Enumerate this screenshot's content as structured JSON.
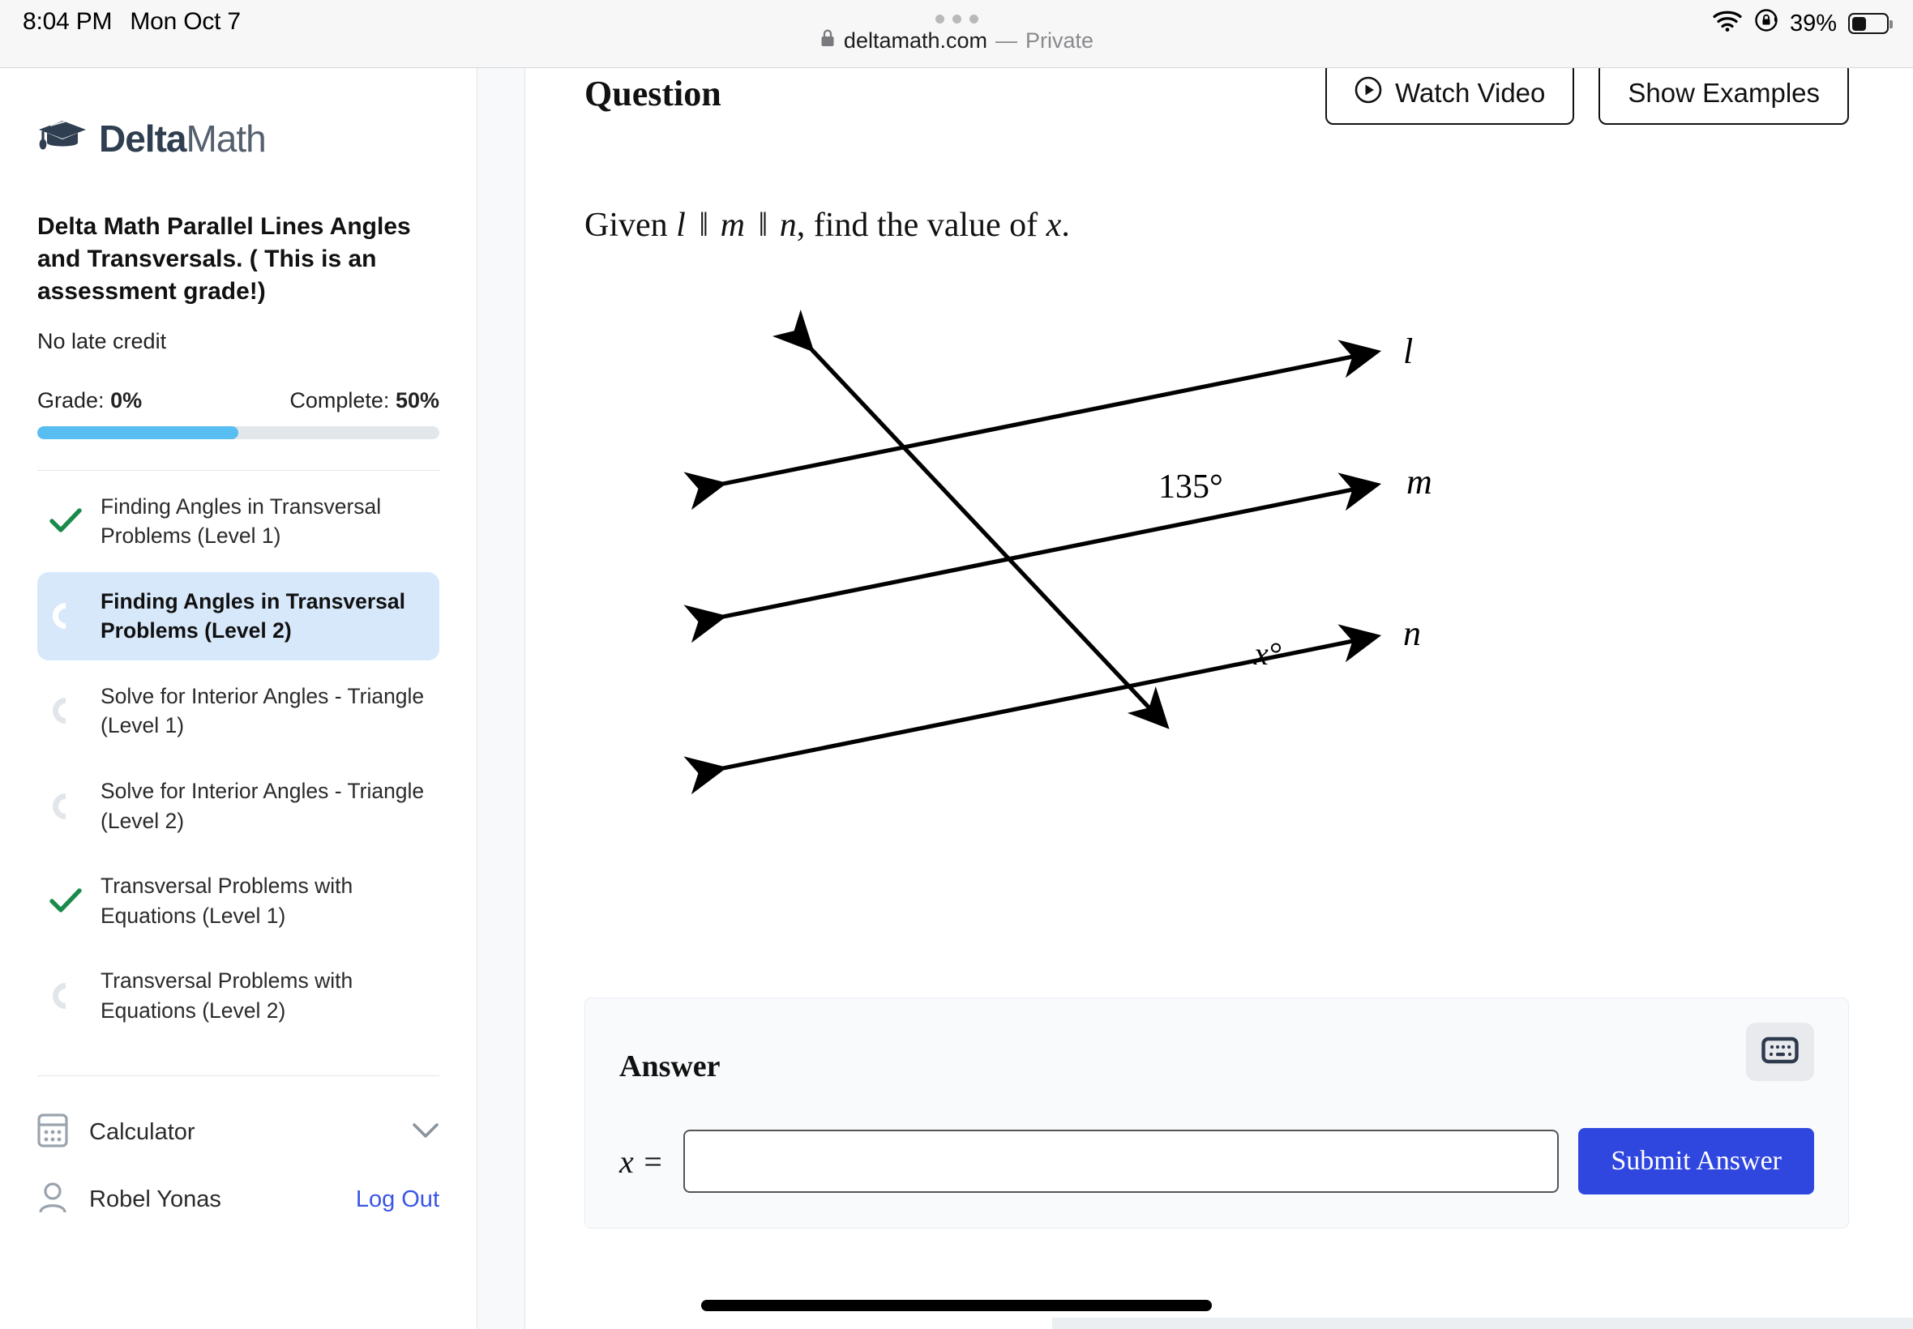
{
  "statusbar": {
    "time": "8:04 PM",
    "date": "Mon Oct 7",
    "battery_percent": "39%",
    "wifi_icon": "wifi-icon",
    "rotation_lock_icon": "rotation-lock-icon",
    "battery_icon": "battery-icon",
    "battery_level": 39
  },
  "browser": {
    "lock_icon": "lock-icon",
    "host": "deltamath.com",
    "separator": "—",
    "mode": "Private",
    "tab_dots_icon": "tab-overview-dots-icon"
  },
  "sidebar": {
    "logo": {
      "icon": "graduation-cap-icon",
      "text_bold": "Delta",
      "text_light": "Math"
    },
    "assignment_title": "Delta Math Parallel Lines Angles and Transversals. ( This is an assessment grade!)",
    "late_credit": "No late credit",
    "grade_label": "Grade:",
    "grade_value": "0%",
    "complete_label": "Complete:",
    "complete_value": "50%",
    "progress_percent": 50,
    "progress_color": "#58bdf0",
    "tasks": [
      {
        "label": "Finding Angles in Transversal Problems (Level 1)",
        "status": "complete",
        "icon": "check-icon",
        "active": false
      },
      {
        "label": "Finding Angles in Transversal Problems (Level 2)",
        "status": "in-progress",
        "icon": "progress-ring-icon",
        "active": true
      },
      {
        "label": "Solve for Interior Angles - Triangle (Level 1)",
        "status": "not-started",
        "icon": "progress-ring-icon",
        "active": false
      },
      {
        "label": "Solve for Interior Angles - Triangle (Level 2)",
        "status": "not-started",
        "icon": "progress-ring-icon",
        "active": false
      },
      {
        "label": "Transversal Problems with Equations (Level 1)",
        "status": "complete",
        "icon": "check-icon",
        "active": false
      },
      {
        "label": "Transversal Problems with Equations (Level 2)",
        "status": "not-started",
        "icon": "progress-ring-icon",
        "active": false
      }
    ],
    "calculator": {
      "label": "Calculator",
      "icon": "calculator-icon",
      "chevron": "chevron-down-icon"
    },
    "user": {
      "name": "Robel Yonas",
      "icon": "person-icon",
      "logout_label": "Log Out",
      "logout_color": "#3a55e6"
    }
  },
  "main": {
    "question_heading": "Question",
    "watch_video_label": "Watch Video",
    "watch_video_icon": "play-circle-icon",
    "show_examples_label": "Show Examples",
    "question_prompt": {
      "lead": "Given",
      "line1": "l",
      "par1": "‖",
      "line2": "m",
      "par2": "‖",
      "line3": "n",
      "tail": ", find the value of",
      "variable": "x",
      "period": "."
    },
    "diagram": {
      "type": "parallel-lines-transversal",
      "line_labels": [
        "l",
        "m",
        "n"
      ],
      "angle_known": "135°",
      "angle_unknown": "x°",
      "stroke_color": "#000000"
    },
    "answer": {
      "title": "Answer",
      "keyboard_icon": "keyboard-icon",
      "prefix": "x =",
      "input_value": "",
      "input_placeholder": "",
      "submit_label": "Submit Answer",
      "submit_color": "#2f46df"
    }
  }
}
